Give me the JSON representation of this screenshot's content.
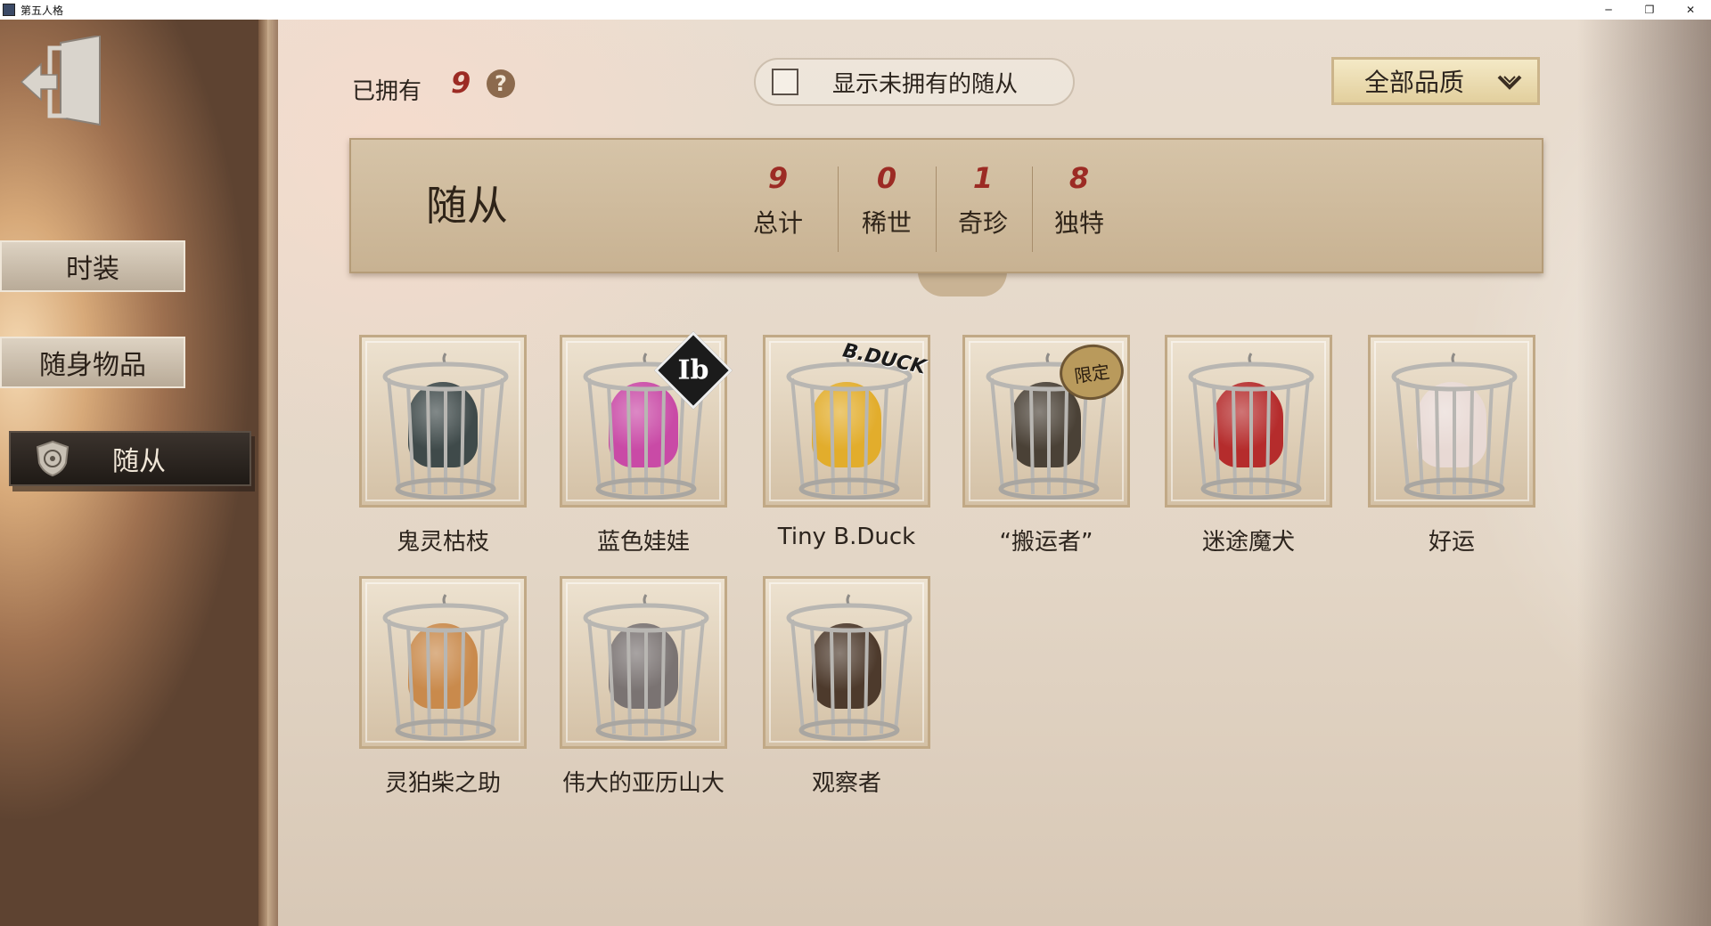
{
  "window": {
    "title": "第五人格",
    "minimize_glyph": "─",
    "restore_glyph": "❐",
    "close_glyph": "✕"
  },
  "nav": {
    "items": [
      {
        "label": "时装"
      },
      {
        "label": "随身物品"
      },
      {
        "label": "随从"
      }
    ],
    "active_index": 2
  },
  "header": {
    "owned_label": "已拥有",
    "owned_count": "9",
    "help_glyph": "?",
    "toggle_label": "显示未拥有的随从",
    "toggle_checked": false,
    "quality_filter": "全部品质"
  },
  "banner": {
    "title": "随从",
    "stats": [
      {
        "value": "9",
        "label": "总计"
      },
      {
        "value": "0",
        "label": "稀世"
      },
      {
        "value": "1",
        "label": "奇珍"
      },
      {
        "value": "8",
        "label": "独特"
      }
    ]
  },
  "items": [
    {
      "name": "鬼灵枯枝",
      "pet_color": "#3f4a4a"
    },
    {
      "name": "蓝色娃娃",
      "pet_color": "#c94aa6",
      "badge": "Ib"
    },
    {
      "name": "Tiny B.Duck",
      "pet_color": "#e2ad2c",
      "badge": "B.DUCK"
    },
    {
      "name": "“搬运者”",
      "pet_color": "#4a4136",
      "badge": "限定"
    },
    {
      "name": "迷途魔犬",
      "pet_color": "#b52c2c"
    },
    {
      "name": "好运",
      "pet_color": "#e8d9d4"
    },
    {
      "name": "灵狛柴之助",
      "pet_color": "#c98a4c"
    },
    {
      "name": "伟大的亚历山大",
      "pet_color": "#7a7372"
    },
    {
      "name": "观察者",
      "pet_color": "#4d3a2c"
    }
  ]
}
